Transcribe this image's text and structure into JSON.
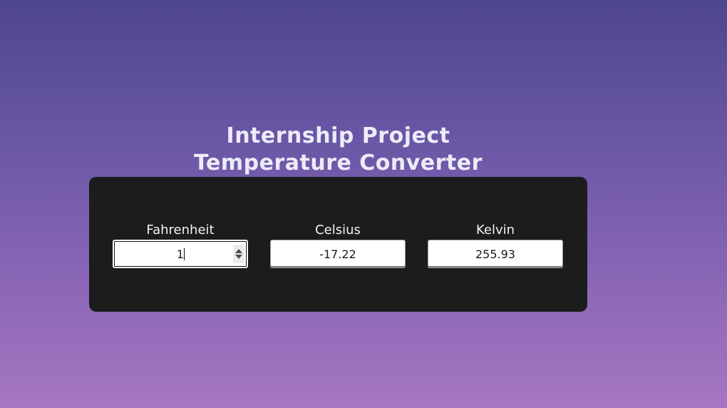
{
  "header": {
    "line1": "Internship Project",
    "line2": "Temperature Converter"
  },
  "converter": {
    "fahrenheit": {
      "label": "Fahrenheit",
      "value": "1"
    },
    "celsius": {
      "label": "Celsius",
      "value": "-17.22"
    },
    "kelvin": {
      "label": "Kelvin",
      "value": "255.93"
    }
  },
  "icons": {
    "spinner": "number-stepper-icon"
  },
  "colors": {
    "panel": "#1c1c1c",
    "title": "#ececf7",
    "gradient_top": "#4e468e",
    "gradient_bottom": "#a677c2"
  }
}
